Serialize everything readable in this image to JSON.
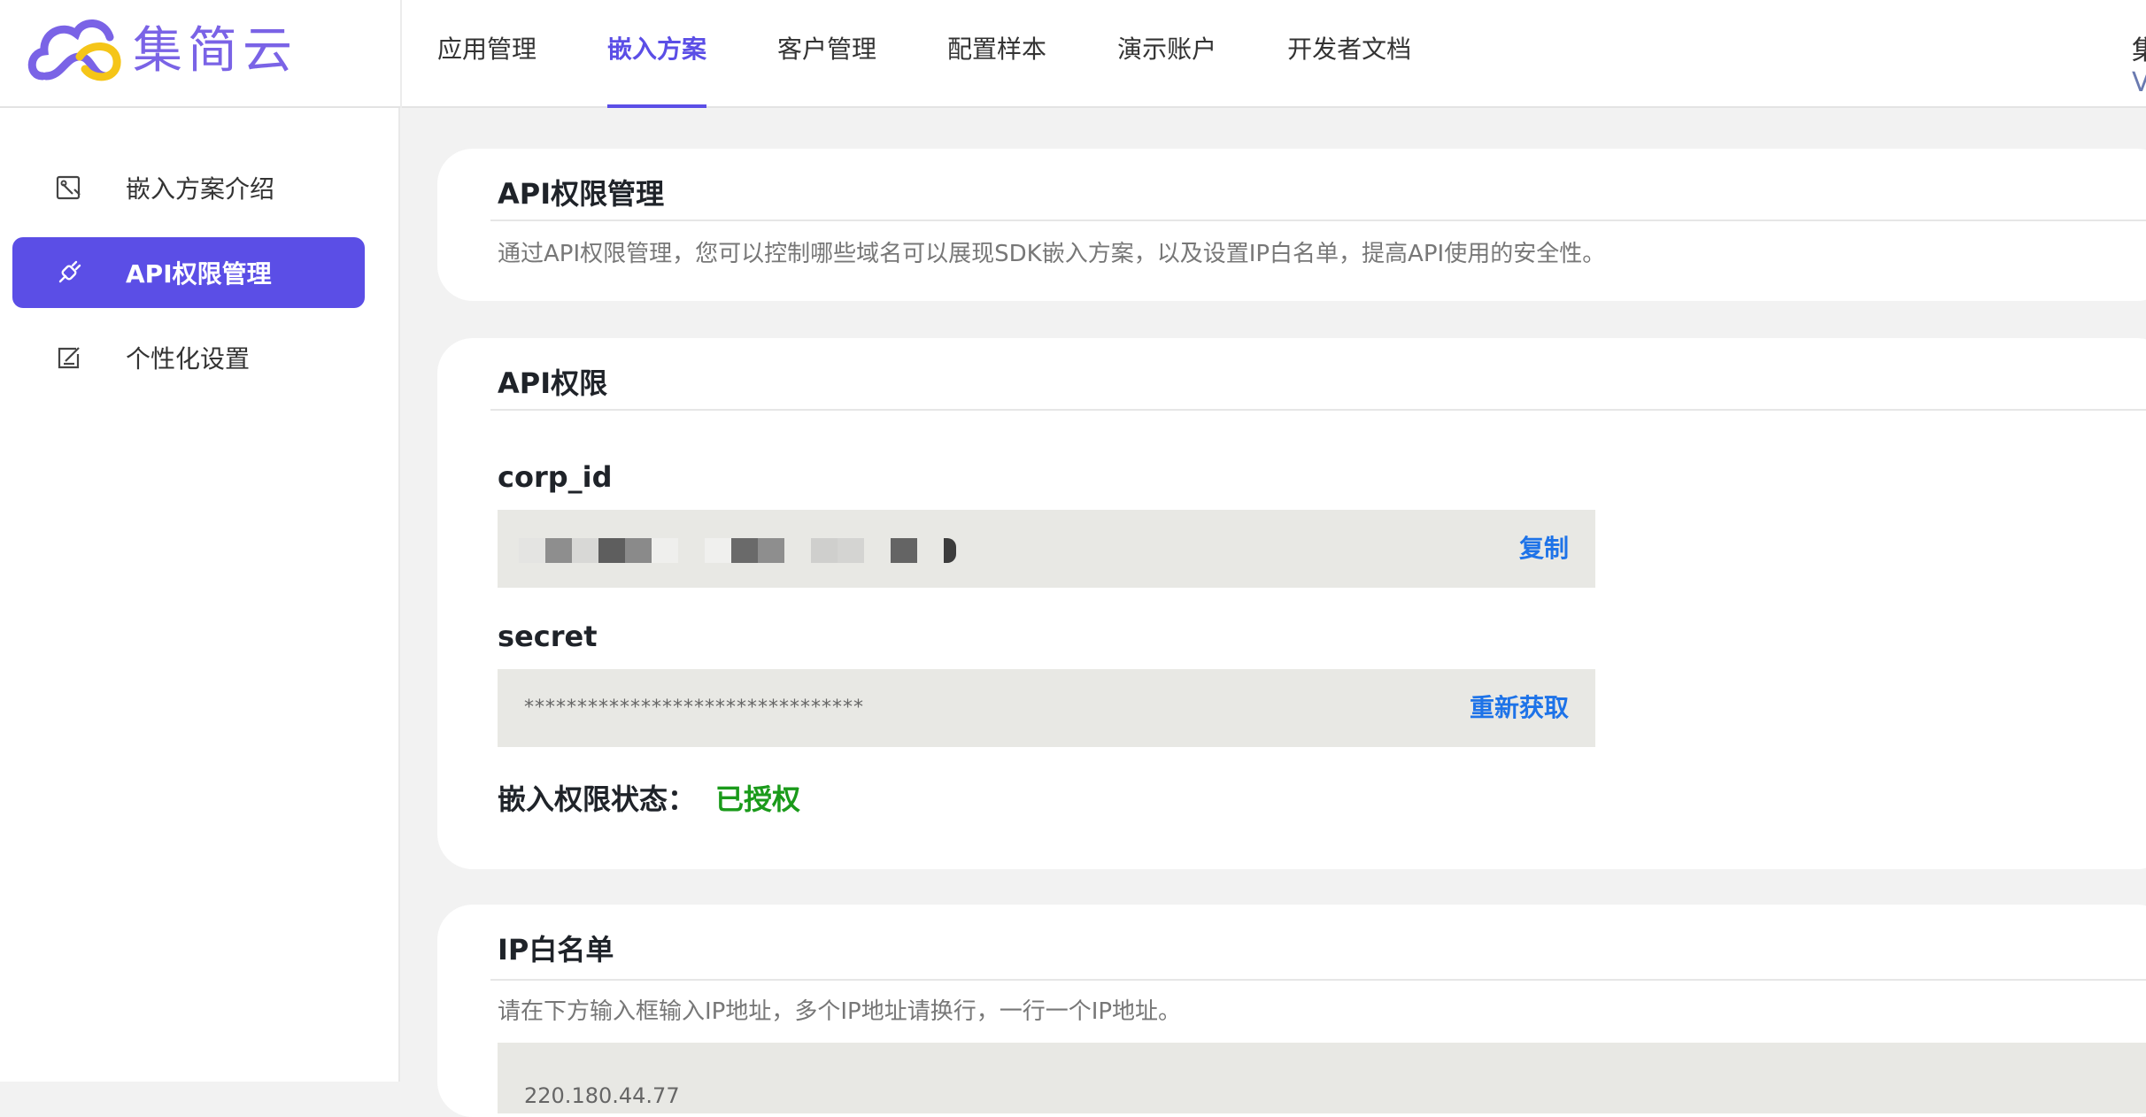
{
  "brand": {
    "name": "集简云",
    "primary_color": "#5b4ee6",
    "logo_accent": "#f5c518"
  },
  "nav": {
    "items": [
      {
        "label": "应用管理",
        "active": false
      },
      {
        "label": "嵌入方案",
        "active": true
      },
      {
        "label": "客户管理",
        "active": false
      },
      {
        "label": "配置样本",
        "active": false
      },
      {
        "label": "演示账户",
        "active": false
      },
      {
        "label": "开发者文档",
        "active": false
      }
    ],
    "user_line1": "集",
    "user_line2": "V"
  },
  "sidebar": {
    "items": [
      {
        "label": "嵌入方案介绍",
        "icon": "image-edit-icon",
        "active": false
      },
      {
        "label": "API权限管理",
        "icon": "plug-icon",
        "active": true
      },
      {
        "label": "个性化设置",
        "icon": "edit-icon",
        "active": false
      }
    ]
  },
  "intro_card": {
    "title": "API权限管理",
    "description": "通过API权限管理，您可以控制哪些域名可以展现SDK嵌入方案，以及设置IP白名单，提高API使用的安全性。"
  },
  "api_card": {
    "title": "API权限",
    "corp_id": {
      "label": "corp_id",
      "action": "复制"
    },
    "secret": {
      "label": "secret",
      "value": "********************************",
      "action": "重新获取"
    },
    "status": {
      "label": "嵌入权限状态：",
      "value": "已授权",
      "value_color": "#1a9a1a"
    }
  },
  "ip_card": {
    "title": "IP白名单",
    "description": "请在下方输入框输入IP地址，多个IP地址请换行，一行一个IP地址。",
    "first_line": "220.180.44.77"
  }
}
